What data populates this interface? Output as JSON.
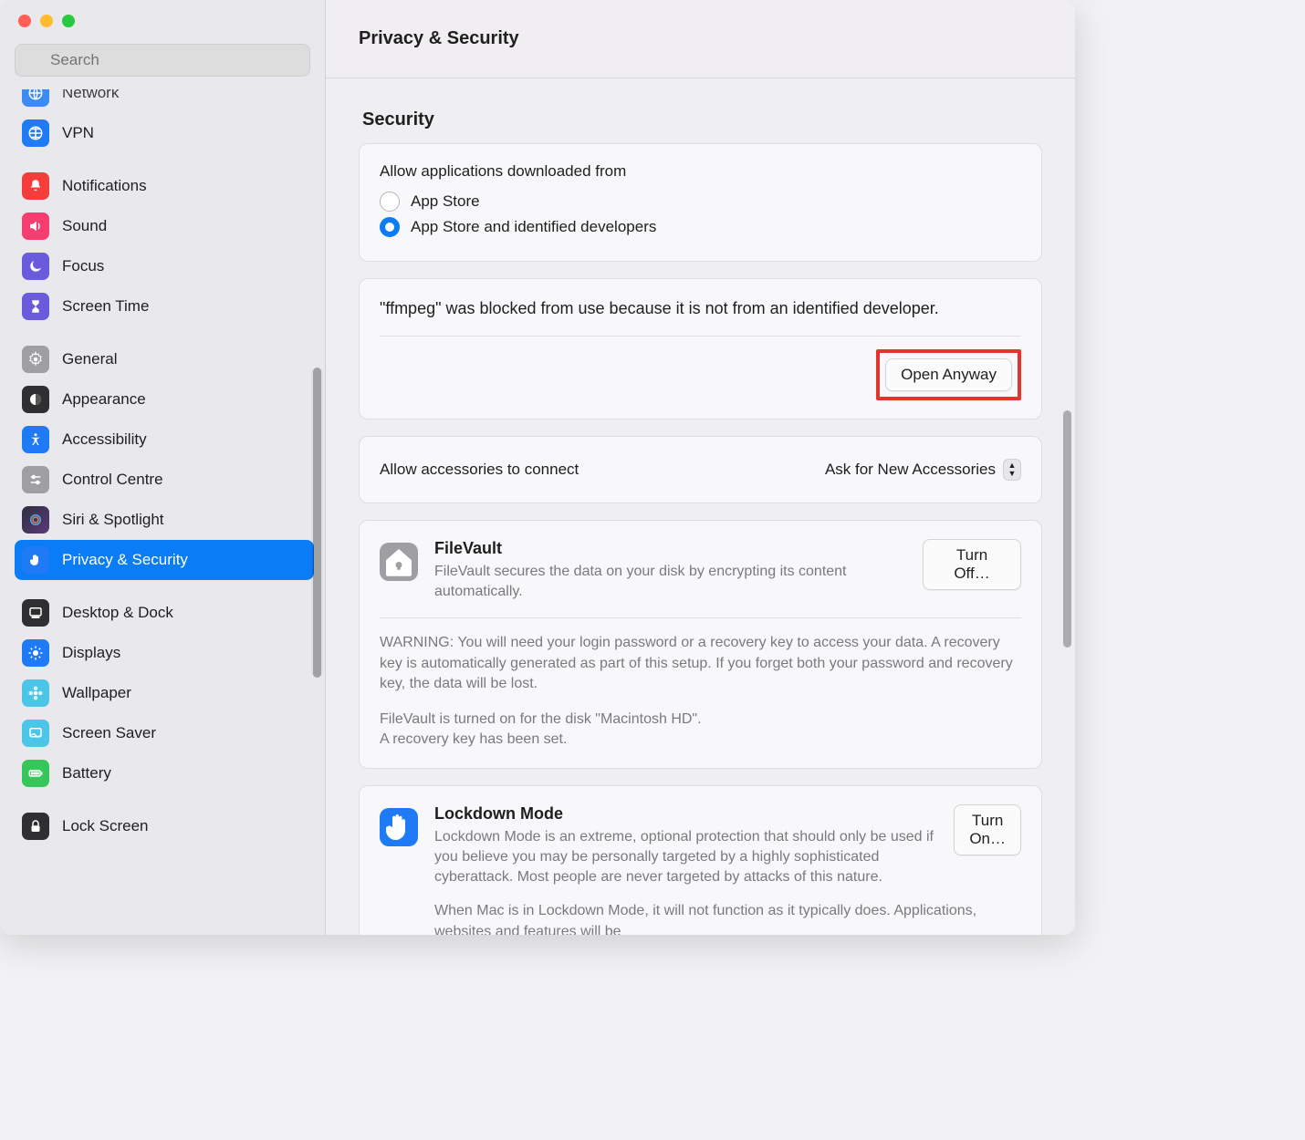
{
  "window": {
    "title": "Privacy & Security"
  },
  "search": {
    "placeholder": "Search"
  },
  "sidebar": {
    "items": [
      {
        "label": "Network"
      },
      {
        "label": "VPN"
      },
      {
        "label": "Notifications"
      },
      {
        "label": "Sound"
      },
      {
        "label": "Focus"
      },
      {
        "label": "Screen Time"
      },
      {
        "label": "General"
      },
      {
        "label": "Appearance"
      },
      {
        "label": "Accessibility"
      },
      {
        "label": "Control Centre"
      },
      {
        "label": "Siri & Spotlight"
      },
      {
        "label": "Privacy & Security"
      },
      {
        "label": "Desktop & Dock"
      },
      {
        "label": "Displays"
      },
      {
        "label": "Wallpaper"
      },
      {
        "label": "Screen Saver"
      },
      {
        "label": "Battery"
      },
      {
        "label": "Lock Screen"
      }
    ]
  },
  "security": {
    "heading": "Security",
    "allow_from_label": "Allow applications downloaded from",
    "radio_app_store": "App Store",
    "radio_app_store_dev": "App Store and identified developers",
    "blocked_message": "\"ffmpeg\" was blocked from use because it is not from an identified developer.",
    "open_anyway": "Open Anyway",
    "accessories_label": "Allow accessories to connect",
    "accessories_value": "Ask for New Accessories"
  },
  "filevault": {
    "title": "FileVault",
    "desc": "FileVault secures the data on your disk by encrypting its content automatically.",
    "turn_off": "Turn Off…",
    "warning": "WARNING: You will need your login password or a recovery key to access your data. A recovery key is automatically generated as part of this setup. If you forget both your password and recovery key, the data will be lost.",
    "status1": "FileVault is turned on for the disk \"Macintosh HD\".",
    "status2": "A recovery key has been set."
  },
  "lockdown": {
    "title": "Lockdown Mode",
    "desc": "Lockdown Mode is an extreme, optional protection that should only be used if you believe you may be personally targeted by a highly sophisticated cyberattack. Most people are never targeted by attacks of this nature.",
    "turn_on": "Turn On…",
    "note": "When Mac is in Lockdown Mode, it will not function as it typically does. Applications, websites and features will be"
  }
}
